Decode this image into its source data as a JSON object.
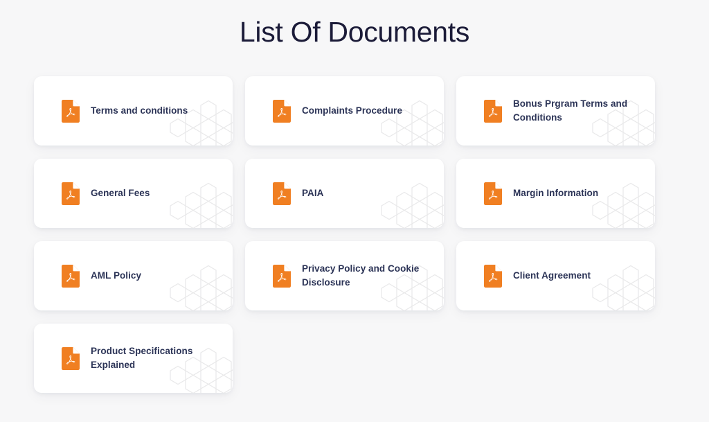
{
  "page": {
    "title": "List Of Documents",
    "background_color": "#f7f7f8",
    "title_color": "#1b1b38"
  },
  "theme": {
    "card_background": "#ffffff",
    "label_color": "#2b3356",
    "pdf_icon_color": "#f07f22",
    "watermark_color": "#ececed"
  },
  "documents": [
    {
      "label": "Terms and conditions",
      "icon": "pdf-file-icon"
    },
    {
      "label": "Complaints Procedure",
      "icon": "pdf-file-icon"
    },
    {
      "label": "Bonus Prgram Terms and Conditions",
      "icon": "pdf-file-icon"
    },
    {
      "label": "General Fees",
      "icon": "pdf-file-icon"
    },
    {
      "label": "PAIA",
      "icon": "pdf-file-icon"
    },
    {
      "label": "Margin Information",
      "icon": "pdf-file-icon"
    },
    {
      "label": "AML Policy",
      "icon": "pdf-file-icon"
    },
    {
      "label": "Privacy Policy and Cookie Disclosure",
      "icon": "pdf-file-icon"
    },
    {
      "label": "Client Agreement",
      "icon": "pdf-file-icon"
    },
    {
      "label": "Product Specifications Explained",
      "icon": "pdf-file-icon"
    }
  ]
}
